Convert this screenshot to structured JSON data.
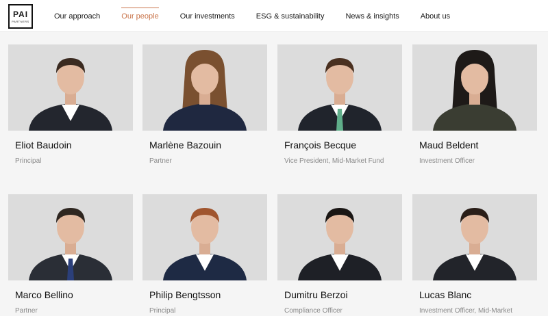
{
  "logo": {
    "main": "PAI",
    "sub": "PARTNERS"
  },
  "nav": [
    {
      "label": "Our approach",
      "active": false
    },
    {
      "label": "Our people",
      "active": true
    },
    {
      "label": "Our investments",
      "active": false
    },
    {
      "label": "ESG & sustainability",
      "active": false
    },
    {
      "label": "News & insights",
      "active": false
    },
    {
      "label": "About us",
      "active": false
    }
  ],
  "people": [
    {
      "name": "Eliot Baudoin",
      "role": "Principal"
    },
    {
      "name": "Marlène Bazouin",
      "role": "Partner"
    },
    {
      "name": "François Becque",
      "role": "Vice President, Mid-Market Fund"
    },
    {
      "name": "Maud Beldent",
      "role": "Investment Officer"
    },
    {
      "name": "Marco Bellino",
      "role": "Partner"
    },
    {
      "name": "Philip Bengtsson",
      "role": "Principal"
    },
    {
      "name": "Dumitru Berzoi",
      "role": "Compliance Officer"
    },
    {
      "name": "Lucas Blanc",
      "role": "Investment Officer, Mid-Market"
    }
  ],
  "colors": {
    "accent": "#c9744a",
    "muted_text": "#8a8a8a",
    "photo_bg": "#dedede"
  }
}
